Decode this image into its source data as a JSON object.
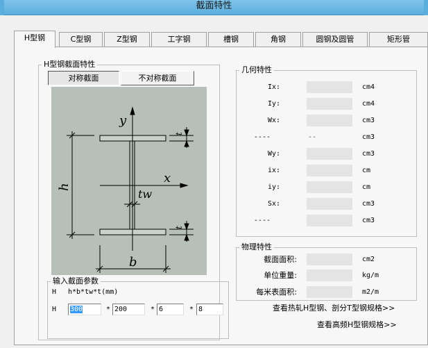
{
  "window": {
    "title": "截面特性"
  },
  "tabs": [
    {
      "label": "H型钢",
      "active": true
    },
    {
      "label": "C型钢",
      "active": false
    },
    {
      "label": "Z型钢",
      "active": false
    },
    {
      "label": "工字钢",
      "active": false
    },
    {
      "label": "槽钢",
      "active": false
    },
    {
      "label": "角钢",
      "active": false
    },
    {
      "label": "圆钢及圆管",
      "active": false
    },
    {
      "label": "矩形管",
      "active": false
    }
  ],
  "section_group": {
    "title": "H型钢截面特性",
    "symmetric_button": "对称截面",
    "asymmetric_button": "不对称截面",
    "selected": "symmetric"
  },
  "diagram": {
    "y_label": "y",
    "x_label": "x",
    "h_label": "h",
    "b_label": "b",
    "tw_label": "tw",
    "t_label": "t"
  },
  "input_group": {
    "title": "输入截面参数",
    "format_key": "H",
    "format_text": "h*b*tw*t(mm)",
    "row_label": "H",
    "separator": "*",
    "values": {
      "h": "300",
      "b": "200",
      "tw": "6",
      "t": "8"
    }
  },
  "geometry_group": {
    "title": "几何特性",
    "rows": [
      {
        "label": "Ix:",
        "value": "",
        "unit": "cm4"
      },
      {
        "label": "Iy:",
        "value": "",
        "unit": "cm4"
      },
      {
        "label": "Wx:",
        "value": "",
        "unit": "cm3"
      },
      {
        "label": "----",
        "value": "--",
        "unit": "cm3"
      },
      {
        "label": "Wy:",
        "value": "",
        "unit": "cm3"
      },
      {
        "label": "ix:",
        "value": "",
        "unit": "cm"
      },
      {
        "label": "iy:",
        "value": "",
        "unit": "cm"
      },
      {
        "label": "Sx:",
        "value": "",
        "unit": "cm3"
      },
      {
        "label": "----",
        "value": "",
        "unit": "cm3"
      }
    ]
  },
  "physical_group": {
    "title": "物理特性",
    "rows": [
      {
        "label": "截面面积:",
        "value": "",
        "unit": "cm2"
      },
      {
        "label": "单位重量:",
        "value": "",
        "unit": "kg/m"
      },
      {
        "label": "每米表面积:",
        "value": "",
        "unit": "m2/m"
      }
    ]
  },
  "links": {
    "hot_rolled": "查看热轧H型钢、剖分T型钢规格>>",
    "high_freq": "查看高频H型钢规格>>"
  }
}
